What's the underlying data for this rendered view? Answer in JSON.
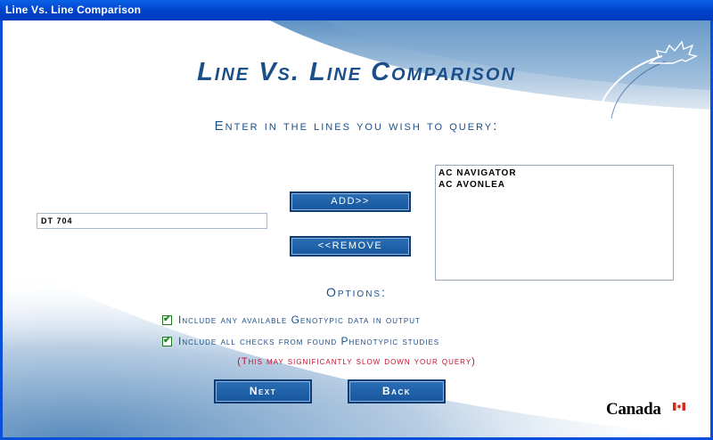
{
  "window": {
    "title": "Line Vs. Line Comparison"
  },
  "main": {
    "title": "Line Vs. Line Comparison",
    "subtitle": "Enter in the lines you wish to query:",
    "line_input": {
      "value": "DT 704",
      "placeholder": ""
    },
    "add_button": "ADD>>",
    "remove_button": "<<REMOVE",
    "selected_lines": [
      "AC NAVIGATOR",
      "AC AVONLEA"
    ],
    "options_label": "Options:",
    "options": [
      {
        "label": "Include any available Genotypic data in output",
        "checked": true
      },
      {
        "label": "Include all checks from found Phenotypic studies",
        "checked": true
      }
    ],
    "warning": "(This may significantly slow down your query)",
    "next_button": "Next",
    "back_button": "Back"
  },
  "footer": {
    "wordmark": "Canada"
  },
  "colors": {
    "titlebar": "#0041c9",
    "heading": "#1b4f8a",
    "button": "#1e62a8",
    "warning": "#c8102e",
    "check": "#1f8a1f"
  },
  "icons": [
    "leaf-logo-icon",
    "checkbox-checked-icon",
    "canada-flag-icon"
  ]
}
